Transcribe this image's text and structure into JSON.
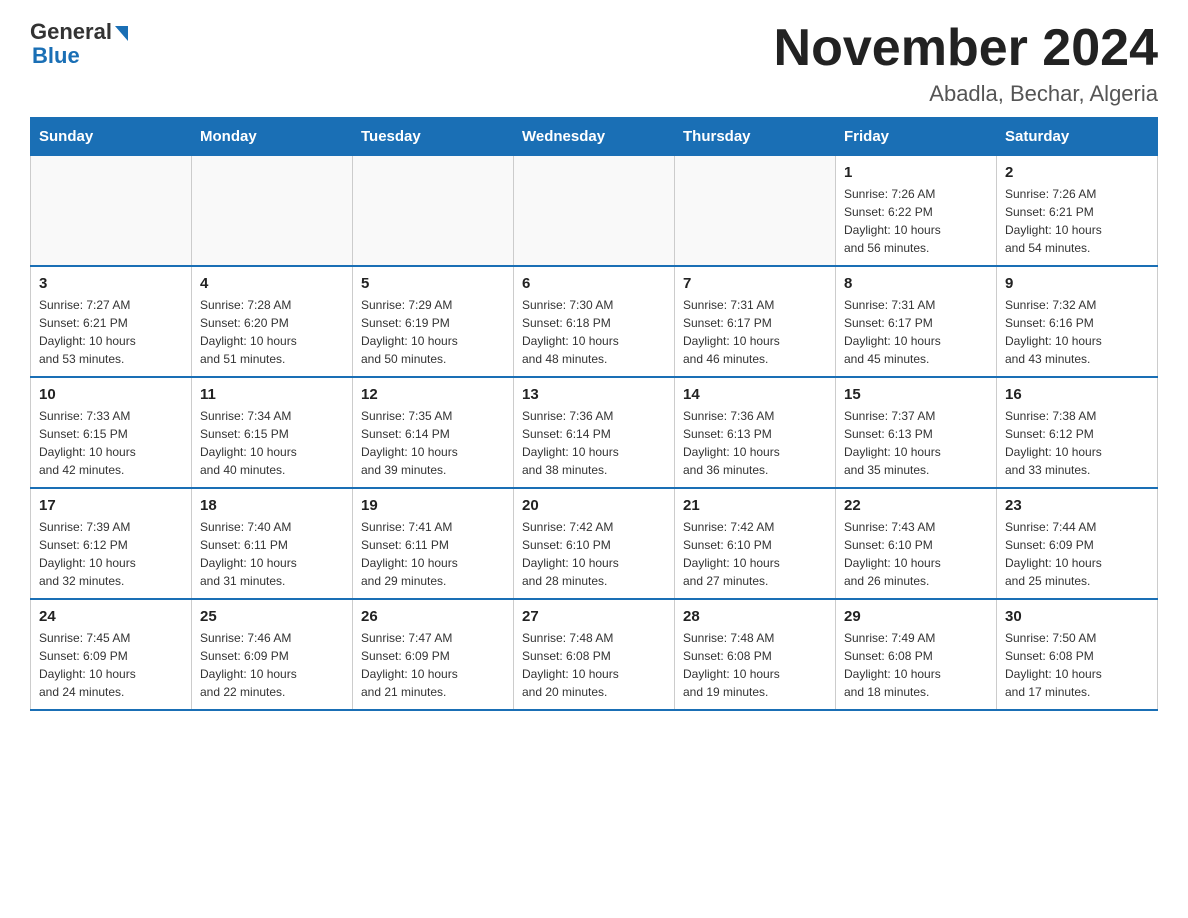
{
  "logo": {
    "line1": "General",
    "line2": "Blue"
  },
  "title": "November 2024",
  "location": "Abadla, Bechar, Algeria",
  "days_of_week": [
    "Sunday",
    "Monday",
    "Tuesday",
    "Wednesday",
    "Thursday",
    "Friday",
    "Saturday"
  ],
  "weeks": [
    [
      {
        "day": "",
        "info": ""
      },
      {
        "day": "",
        "info": ""
      },
      {
        "day": "",
        "info": ""
      },
      {
        "day": "",
        "info": ""
      },
      {
        "day": "",
        "info": ""
      },
      {
        "day": "1",
        "info": "Sunrise: 7:26 AM\nSunset: 6:22 PM\nDaylight: 10 hours\nand 56 minutes."
      },
      {
        "day": "2",
        "info": "Sunrise: 7:26 AM\nSunset: 6:21 PM\nDaylight: 10 hours\nand 54 minutes."
      }
    ],
    [
      {
        "day": "3",
        "info": "Sunrise: 7:27 AM\nSunset: 6:21 PM\nDaylight: 10 hours\nand 53 minutes."
      },
      {
        "day": "4",
        "info": "Sunrise: 7:28 AM\nSunset: 6:20 PM\nDaylight: 10 hours\nand 51 minutes."
      },
      {
        "day": "5",
        "info": "Sunrise: 7:29 AM\nSunset: 6:19 PM\nDaylight: 10 hours\nand 50 minutes."
      },
      {
        "day": "6",
        "info": "Sunrise: 7:30 AM\nSunset: 6:18 PM\nDaylight: 10 hours\nand 48 minutes."
      },
      {
        "day": "7",
        "info": "Sunrise: 7:31 AM\nSunset: 6:17 PM\nDaylight: 10 hours\nand 46 minutes."
      },
      {
        "day": "8",
        "info": "Sunrise: 7:31 AM\nSunset: 6:17 PM\nDaylight: 10 hours\nand 45 minutes."
      },
      {
        "day": "9",
        "info": "Sunrise: 7:32 AM\nSunset: 6:16 PM\nDaylight: 10 hours\nand 43 minutes."
      }
    ],
    [
      {
        "day": "10",
        "info": "Sunrise: 7:33 AM\nSunset: 6:15 PM\nDaylight: 10 hours\nand 42 minutes."
      },
      {
        "day": "11",
        "info": "Sunrise: 7:34 AM\nSunset: 6:15 PM\nDaylight: 10 hours\nand 40 minutes."
      },
      {
        "day": "12",
        "info": "Sunrise: 7:35 AM\nSunset: 6:14 PM\nDaylight: 10 hours\nand 39 minutes."
      },
      {
        "day": "13",
        "info": "Sunrise: 7:36 AM\nSunset: 6:14 PM\nDaylight: 10 hours\nand 38 minutes."
      },
      {
        "day": "14",
        "info": "Sunrise: 7:36 AM\nSunset: 6:13 PM\nDaylight: 10 hours\nand 36 minutes."
      },
      {
        "day": "15",
        "info": "Sunrise: 7:37 AM\nSunset: 6:13 PM\nDaylight: 10 hours\nand 35 minutes."
      },
      {
        "day": "16",
        "info": "Sunrise: 7:38 AM\nSunset: 6:12 PM\nDaylight: 10 hours\nand 33 minutes."
      }
    ],
    [
      {
        "day": "17",
        "info": "Sunrise: 7:39 AM\nSunset: 6:12 PM\nDaylight: 10 hours\nand 32 minutes."
      },
      {
        "day": "18",
        "info": "Sunrise: 7:40 AM\nSunset: 6:11 PM\nDaylight: 10 hours\nand 31 minutes."
      },
      {
        "day": "19",
        "info": "Sunrise: 7:41 AM\nSunset: 6:11 PM\nDaylight: 10 hours\nand 29 minutes."
      },
      {
        "day": "20",
        "info": "Sunrise: 7:42 AM\nSunset: 6:10 PM\nDaylight: 10 hours\nand 28 minutes."
      },
      {
        "day": "21",
        "info": "Sunrise: 7:42 AM\nSunset: 6:10 PM\nDaylight: 10 hours\nand 27 minutes."
      },
      {
        "day": "22",
        "info": "Sunrise: 7:43 AM\nSunset: 6:10 PM\nDaylight: 10 hours\nand 26 minutes."
      },
      {
        "day": "23",
        "info": "Sunrise: 7:44 AM\nSunset: 6:09 PM\nDaylight: 10 hours\nand 25 minutes."
      }
    ],
    [
      {
        "day": "24",
        "info": "Sunrise: 7:45 AM\nSunset: 6:09 PM\nDaylight: 10 hours\nand 24 minutes."
      },
      {
        "day": "25",
        "info": "Sunrise: 7:46 AM\nSunset: 6:09 PM\nDaylight: 10 hours\nand 22 minutes."
      },
      {
        "day": "26",
        "info": "Sunrise: 7:47 AM\nSunset: 6:09 PM\nDaylight: 10 hours\nand 21 minutes."
      },
      {
        "day": "27",
        "info": "Sunrise: 7:48 AM\nSunset: 6:08 PM\nDaylight: 10 hours\nand 20 minutes."
      },
      {
        "day": "28",
        "info": "Sunrise: 7:48 AM\nSunset: 6:08 PM\nDaylight: 10 hours\nand 19 minutes."
      },
      {
        "day": "29",
        "info": "Sunrise: 7:49 AM\nSunset: 6:08 PM\nDaylight: 10 hours\nand 18 minutes."
      },
      {
        "day": "30",
        "info": "Sunrise: 7:50 AM\nSunset: 6:08 PM\nDaylight: 10 hours\nand 17 minutes."
      }
    ]
  ]
}
